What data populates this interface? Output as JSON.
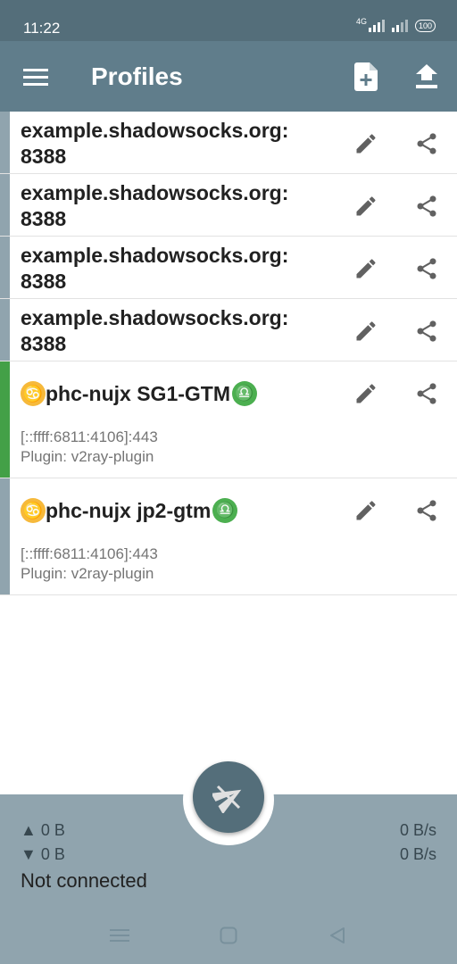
{
  "status_bar": {
    "time": "11:22",
    "network": "4G",
    "battery": "100"
  },
  "toolbar": {
    "title": "Profiles",
    "menu_icon": "menu-icon",
    "add_icon": "add-file-icon",
    "upload_icon": "upload-icon"
  },
  "profiles": [
    {
      "name": "example.shadowsocks.org:\n8388"
    },
    {
      "name": "example.shadowsocks.org:\n8388"
    },
    {
      "name": "example.shadowsocks.org:\n8388"
    },
    {
      "name": "example.shadowsocks.org:\n8388"
    },
    {
      "emoji_start": "♋",
      "label": "phc-nujx SG1-GTM",
      "emoji_end": "♎",
      "address": "[::ffff:6811:4106]:443",
      "plugin": "Plugin: v2ray-plugin",
      "active": true
    },
    {
      "emoji_start": "♋",
      "label": "phc-nujx jp2-gtm",
      "emoji_end": "♎",
      "address": "[::ffff:6811:4106]:443",
      "plugin": "Plugin: v2ray-plugin",
      "active": false
    }
  ],
  "stats": {
    "tx": "▲ 0 B",
    "rx": "▼ 0 B",
    "tx_rate": "0 B/s",
    "rx_rate": "0 B/s",
    "status": "Not connected"
  },
  "colors": {
    "status_bar": "#546e7a",
    "app_bar": "#607d8b",
    "bottom_bar": "#90a4ae",
    "active_indicator": "#43a047",
    "fab": "#546e7a"
  }
}
